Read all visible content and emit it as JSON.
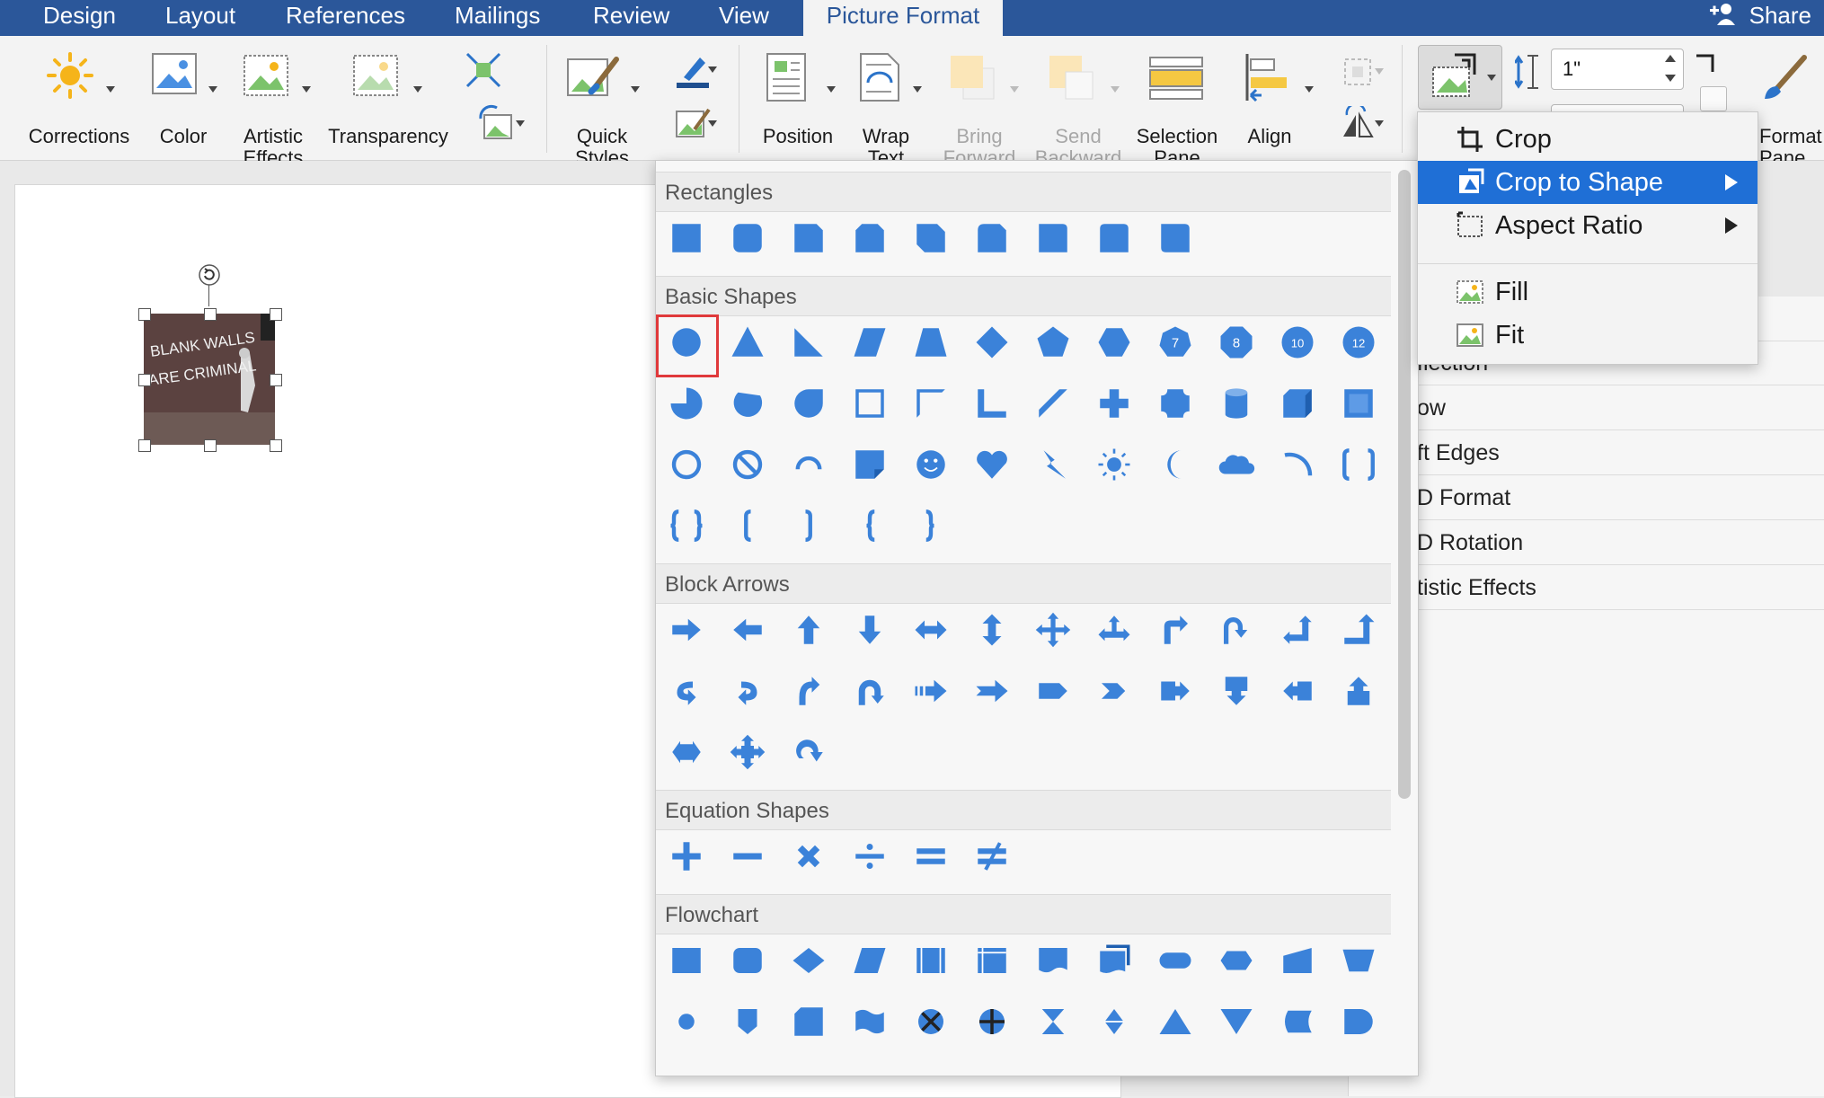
{
  "tabs": [
    {
      "label": "Design",
      "active": false
    },
    {
      "label": "Layout",
      "active": false
    },
    {
      "label": "References",
      "active": false
    },
    {
      "label": "Mailings",
      "active": false
    },
    {
      "label": "Review",
      "active": false
    },
    {
      "label": "View",
      "active": false
    },
    {
      "label": "Picture Format",
      "active": true
    }
  ],
  "share_label": "Share",
  "ribbon": {
    "corrections": "Corrections",
    "color": "Color",
    "artistic_1": "Artistic",
    "artistic_2": "Effects",
    "transparency": "Transparency",
    "quick_1": "Quick",
    "quick_2": "Styles",
    "position": "Position",
    "wrap_1": "Wrap",
    "wrap_2": "Text",
    "bring_1": "Bring",
    "bring_2": "Forward",
    "send_1": "Send",
    "send_2": "Backward",
    "selection_1": "Selection",
    "selection_2": "Pane",
    "align": "Align",
    "size_value": "1\"",
    "format_1": "Format",
    "format_2": "Pane"
  },
  "gallery": {
    "sections": [
      {
        "title": "Rectangles"
      },
      {
        "title": "Basic Shapes"
      },
      {
        "title": "Block Arrows"
      },
      {
        "title": "Equation Shapes"
      },
      {
        "title": "Flowchart"
      }
    ],
    "selected_shape": "oval",
    "shape_color": "#3b82d9",
    "number_badges": [
      "7",
      "8",
      "10",
      "12"
    ]
  },
  "crop_menu": {
    "items": [
      {
        "label": "Crop",
        "icon": "crop-icon",
        "highlighted": false,
        "submenu": false
      },
      {
        "label": "Crop to Shape",
        "icon": "crop-to-shape-icon",
        "highlighted": true,
        "submenu": true
      },
      {
        "label": "Aspect Ratio",
        "icon": "aspect-ratio-icon",
        "highlighted": false,
        "submenu": true
      },
      {
        "label": "Fill",
        "icon": "fill-icon",
        "highlighted": false,
        "submenu": false
      },
      {
        "label": "Fit",
        "icon": "fit-icon",
        "highlighted": false,
        "submenu": false
      }
    ]
  },
  "task_pane": {
    "rows": [
      "flection",
      "ow",
      "ft Edges",
      "D Format",
      "D Rotation",
      "tistic Effects"
    ]
  },
  "picture": {
    "caption_line1": "BLANK WALLS",
    "caption_line2": "ARE CRIMINAL"
  },
  "colors": {
    "tabbar": "#2b579a",
    "highlight": "#1f6fd6",
    "selection_border": "#e0393b",
    "shape_fill": "#3b82d9"
  }
}
